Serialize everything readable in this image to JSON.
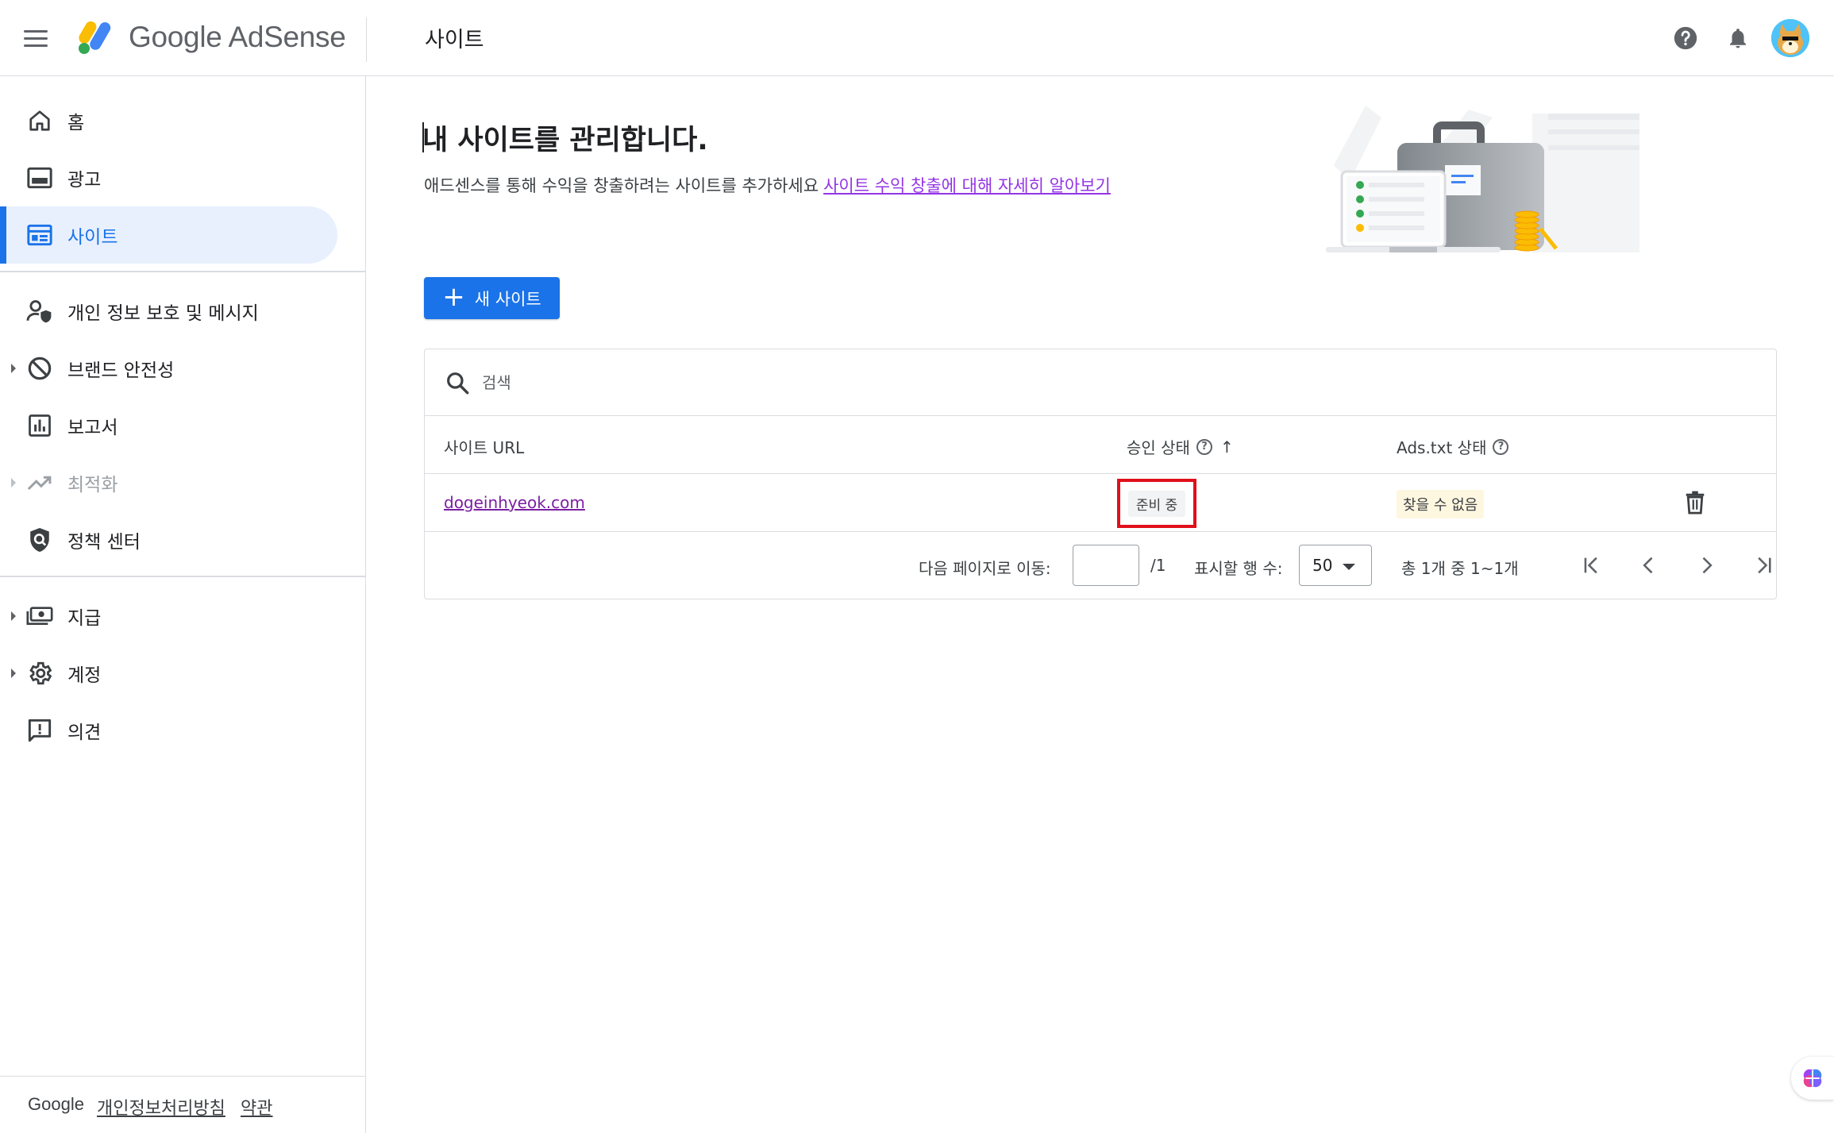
{
  "header": {
    "brand": "Google AdSense",
    "page_title": "사이트",
    "icons": [
      "menu-icon",
      "help-icon",
      "notifications-icon",
      "avatar"
    ]
  },
  "sidebar": {
    "items": [
      {
        "label": "홈",
        "icon": "home-icon"
      },
      {
        "label": "광고",
        "icon": "ads-icon"
      },
      {
        "label": "사이트",
        "icon": "sites-icon",
        "active": true
      },
      {
        "label": "개인 정보 보호 및 메시지",
        "icon": "privacy-icon"
      },
      {
        "label": "브랜드 안전성",
        "icon": "block-icon",
        "expandable": true
      },
      {
        "label": "보고서",
        "icon": "reports-icon"
      },
      {
        "label": "최적화",
        "icon": "trending-icon",
        "expandable": true,
        "disabled": true
      },
      {
        "label": "정책 센터",
        "icon": "policy-icon"
      },
      {
        "label": "지급",
        "icon": "payments-icon",
        "expandable": true
      },
      {
        "label": "계정",
        "icon": "settings-icon",
        "expandable": true
      },
      {
        "label": "의견",
        "icon": "feedback-icon"
      }
    ],
    "footer": {
      "brand": "Google",
      "privacy_link": "개인정보처리방침",
      "terms_link": "약관"
    }
  },
  "main": {
    "heading": "내 사이트를 관리합니다.",
    "subtext": "애드센스를 통해 수익을 창출하려는 사이트를 추가하세요",
    "learn_more_link": "사이트 수익 창출에 대해 자세히 알아보기",
    "new_site_button": "새 사이트",
    "search": {
      "placeholder": "검색",
      "value": ""
    },
    "table": {
      "columns": [
        "사이트 URL",
        "승인 상태",
        "Ads.txt 상태"
      ],
      "rows": [
        {
          "url": "dogeinhyeok.com",
          "approval_status": "준비 중",
          "ads_txt_status": "찾을 수 없음"
        }
      ],
      "footer": {
        "goto_label": "다음 페이지로 이동:",
        "goto_value": "",
        "total_pages": "/1",
        "rows_per_page_label": "표시할 행 수:",
        "rows_per_page": "50",
        "range_text": "총 1개 중 1~1개"
      }
    }
  },
  "colors": {
    "primary": "#1a73e8",
    "active_nav_bg": "#e8f0fe",
    "link_visited": "#7b1fa2",
    "highlight_box": "#e0101a",
    "ads_chip_bg": "#fef7e0"
  }
}
